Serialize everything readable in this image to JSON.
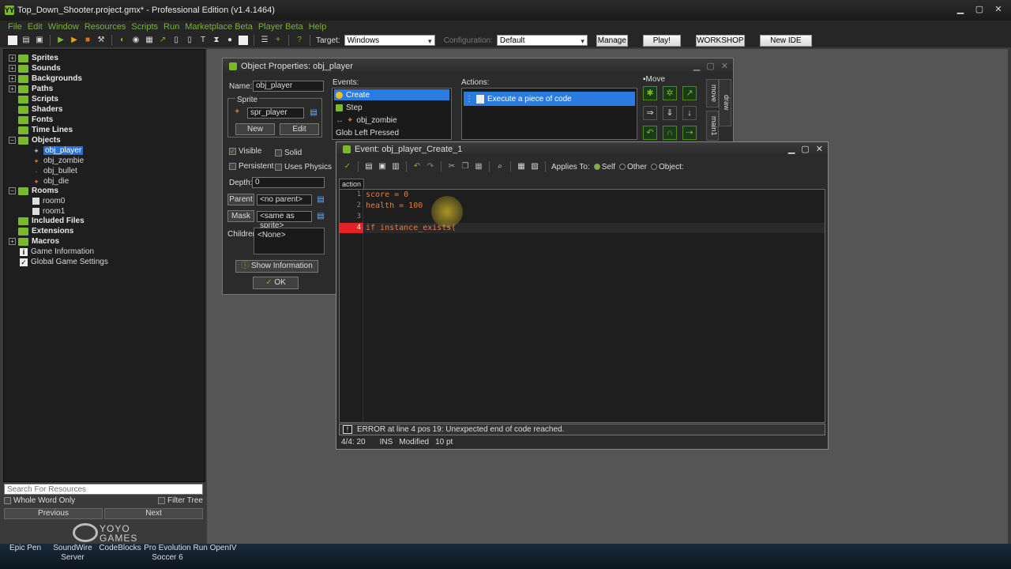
{
  "window": {
    "title": "Top_Down_Shooter.project.gmx* - Professional Edition (v1.4.1464)",
    "logo_glyph": "YY",
    "minimize": "▁",
    "maximize": "▢",
    "close": "✕"
  },
  "menu": [
    "File",
    "Edit",
    "Window",
    "Resources",
    "Scripts",
    "Run",
    "Marketplace Beta",
    "Player Beta",
    "Help"
  ],
  "toolbar": {
    "target_label": "Target:",
    "target_value": "Windows",
    "config_label": "Configuration:",
    "config_value": "Default",
    "manage": "Manage",
    "play": "Play!",
    "workshop": "WORKSHOP",
    "new_ide": "New IDE"
  },
  "tree": {
    "sprites": "Sprites",
    "sounds": "Sounds",
    "backgrounds": "Backgrounds",
    "paths": "Paths",
    "scripts": "Scripts",
    "shaders": "Shaders",
    "fonts": "Fonts",
    "timelines": "Time Lines",
    "objects": "Objects",
    "obj_player": "obj_player",
    "obj_zombie": "obj_zombie",
    "obj_bullet": "obj_bullet",
    "obj_die": "obj_die",
    "rooms": "Rooms",
    "room0": "room0",
    "room1": "room1",
    "included_files": "Included Files",
    "extensions": "Extensions",
    "macros": "Macros",
    "game_information": "Game Information",
    "global_game_settings": "Global Game Settings",
    "expand_plus": "+",
    "expand_minus": "−"
  },
  "search": {
    "placeholder": "Search For Resources",
    "whole_word": "Whole Word Only",
    "filter_tree": "Filter Tree",
    "previous": "Previous",
    "next": "Next"
  },
  "brand": {
    "line1": "YOYO",
    "line2": "GAMES"
  },
  "object_props": {
    "title": "Object Properties: obj_player",
    "name_label": "Name:",
    "name_value": "obj_player",
    "sprite_group": "Sprite",
    "sprite_value": "spr_player",
    "new": "New",
    "edit": "Edit",
    "visible": "Visible",
    "solid": "Solid",
    "persistent": "Persistent",
    "uses_physics": "Uses Physics",
    "depth_label": "Depth:",
    "depth_value": "0",
    "parent": "Parent",
    "parent_value": "<no parent>",
    "mask": "Mask",
    "mask_value": "<same as sprite>",
    "children_label": "Children:",
    "children_value": "<None>",
    "show_info": "Show Information",
    "ok": "OK",
    "events_label": "Events:",
    "events": [
      "Create",
      "Step",
      "obj_zombie",
      "Glob Left Pressed"
    ],
    "actions_label": "Actions:",
    "action_item": "Execute a piece of code",
    "move_label": "Move",
    "tab_move": "move",
    "tab_main1": "main1",
    "tab_draw": "draw"
  },
  "code_window": {
    "title": "Event: obj_player_Create_1",
    "applies_to": "Applies To:",
    "self": "Self",
    "other": "Other",
    "object": "Object:",
    "tab": "action",
    "lines": [
      "1",
      "2",
      "3",
      "4"
    ],
    "code": [
      "score = 0",
      "health = 100",
      "",
      "if instance_exists("
    ],
    "error": "ERROR at line 4 pos 19: Unexpected end of code reached.",
    "warn_glyph": "!",
    "status": {
      "pos": "4/4: 20",
      "mode": "INS",
      "modified": "Modified",
      "size": "10 pt"
    }
  },
  "taskbar": [
    {
      "l1": "Epic Pen",
      "l2": ""
    },
    {
      "l1": "SoundWire",
      "l2": "Server"
    },
    {
      "l1": "CodeBlocks",
      "l2": ""
    },
    {
      "l1": "Pro Evolution",
      "l2": "Soccer 6"
    },
    {
      "l1": "Run OpenIV",
      "l2": ""
    }
  ]
}
